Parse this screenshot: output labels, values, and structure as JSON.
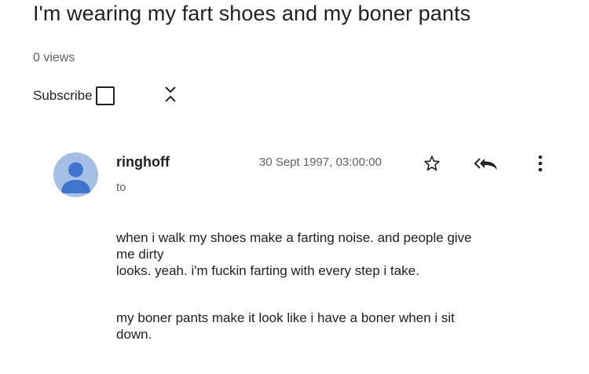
{
  "email": {
    "subject": "I'm wearing my fart shoes and my boner pants",
    "views": "0 views",
    "subscribe_label": "Subscribe",
    "sender": "ringhoff",
    "to_label": "to",
    "date": "30 Sept 1997, 03:00:00",
    "body": {
      "p1_line1": "when i walk my shoes make a farting noise. and people give",
      "p1_line2": "me dirty",
      "p1_line3": "looks. yeah. i'm fuckin farting with every step i take.",
      "p2_line1": "my boner pants make it look like i have a boner when i sit",
      "p2_line2": "down."
    }
  },
  "icons": {
    "expand": "unfold-icon",
    "star": "star-icon",
    "reply": "reply-all-icon",
    "more": "more-vert-icon",
    "avatar": "person-avatar-icon"
  },
  "colors": {
    "avatar_bg": "#a5c0e4",
    "avatar_fg": "#3f74cf",
    "text": "#202124",
    "muted": "#5f6368"
  }
}
